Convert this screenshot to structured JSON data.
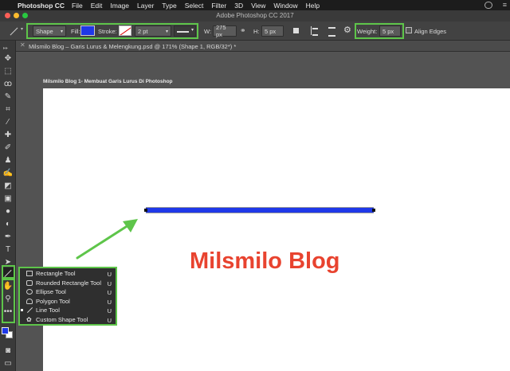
{
  "menubar": {
    "app_name": "Photoshop CC",
    "items": [
      "File",
      "Edit",
      "Image",
      "Layer",
      "Type",
      "Select",
      "Filter",
      "3D",
      "View",
      "Window",
      "Help"
    ]
  },
  "window": {
    "title": "Adobe Photoshop CC 2017"
  },
  "options_bar": {
    "tool_mode": "Shape",
    "fill_label": "Fill:",
    "fill_color": "#1f38e8",
    "stroke_label": "Stroke:",
    "stroke_width": "2 pt",
    "w_label": "W:",
    "w_value": "275 px",
    "h_label": "H:",
    "h_value": "5 px",
    "weight_label": "Weight:",
    "weight_value": "5 px",
    "align_edges_label": "Align Edges"
  },
  "document": {
    "tab_title": "Milsmilo Blog – Garis Lurus & Melengkung.psd @ 171% (Shape 1, RGB/32*) *",
    "canvas_caption": "Milsmilo Blog 1- Membuat Garis Lurus Di Photoshop",
    "heading": "Milsmilo Blog",
    "heading_color": "#e8432f",
    "line_color": "#1f38e8"
  },
  "tools_panel": {
    "foreground_color": "#1f38e8",
    "background_color": "#ffffff",
    "icons": [
      "move-icon",
      "marquee-icon",
      "lasso-icon",
      "quick-select-icon",
      "crop-icon",
      "eyedropper-icon",
      "healing-brush-icon",
      "brush-icon",
      "clone-stamp-icon",
      "history-brush-icon",
      "eraser-icon",
      "gradient-icon",
      "blur-icon",
      "dodge-icon",
      "pen-icon",
      "type-icon",
      "path-select-icon",
      "line-tool-icon",
      "hand-icon",
      "zoom-icon",
      "more-tools-icon"
    ]
  },
  "flyout": {
    "items": [
      {
        "label": "Rectangle Tool",
        "shortcut": "U"
      },
      {
        "label": "Rounded Rectangle Tool",
        "shortcut": "U"
      },
      {
        "label": "Ellipse Tool",
        "shortcut": "U"
      },
      {
        "label": "Polygon Tool",
        "shortcut": "U"
      },
      {
        "label": "Line Tool",
        "shortcut": "U"
      },
      {
        "label": "Custom Shape Tool",
        "shortcut": "U"
      }
    ],
    "selected_index": 4
  },
  "annotation": {
    "highlight_color": "#5ec54a"
  }
}
